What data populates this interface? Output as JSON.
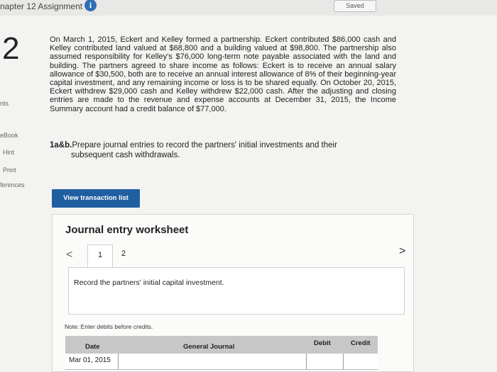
{
  "header": {
    "title": "napter 12 Assignment",
    "info_icon": "i",
    "saved_label": "Saved"
  },
  "question": {
    "number": "2"
  },
  "sidebar": {
    "items": [
      {
        "label": "nts"
      },
      {
        "label": "eBook"
      },
      {
        "label": "Hint"
      },
      {
        "label": "Print"
      },
      {
        "label": "ferences"
      }
    ]
  },
  "problem": {
    "text": "On March 1, 2015, Eckert and Kelley formed a partnership. Eckert contributed $86,000 cash and Kelley contributed land valued at $68,800 and a building valued at $98,800. The partnership also assumed responsibility for Kelley's $76,000 long-term note payable associated with the land and building. The partners agreed to share income as follows: Eckert is to receive an annual salary allowance of $30,500, both are to receive an annual interest allowance of 8% of their beginning-year capital investment, and any remaining income or loss is to be shared equally. On October 20, 2015, Eckert withdrew $29,000 cash and Kelley withdrew $22,000 cash. After the adjusting and closing entries are made to the revenue and expense accounts at December 31, 2015, the Income Summary account had a credit balance of $77,000."
  },
  "instruction": {
    "prefix": "1a&b.",
    "line1": "Prepare journal entries to record the partners' initial investments and their",
    "line2": "subsequent cash withdrawals."
  },
  "view_transactions": {
    "label": "View transaction list"
  },
  "worksheet": {
    "title": "Journal entry worksheet",
    "prev": "<",
    "next": ">",
    "tabs": [
      "1",
      "2"
    ],
    "record_text": "Record the partners' initial capital investment.",
    "note": "Note: Enter debits before credits.",
    "columns": {
      "date": "Date",
      "general_journal": "General Journal",
      "debit": "Debit",
      "credit": "Credit"
    },
    "rows": [
      {
        "date": "Mar 01, 2015"
      }
    ]
  }
}
